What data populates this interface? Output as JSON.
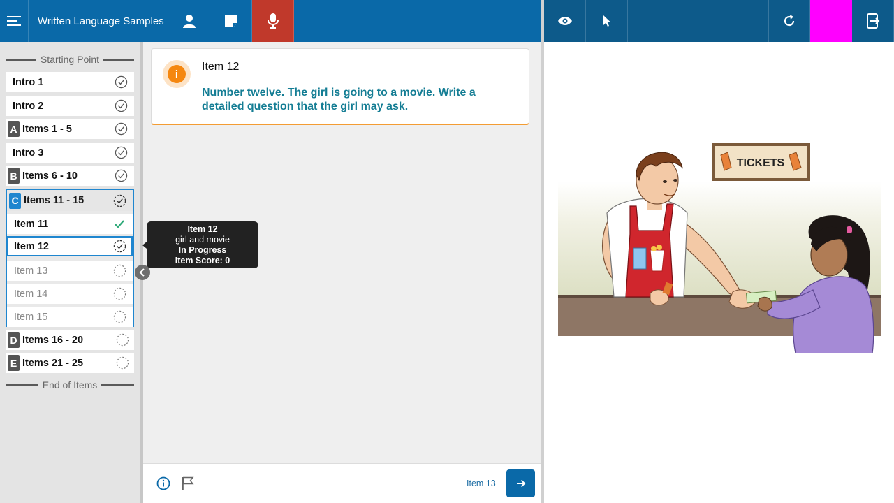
{
  "header": {
    "app_title": "Written Language Samples",
    "icons": [
      "hamburger-menu-icon",
      "person-icon",
      "note-icon",
      "microphone-icon"
    ]
  },
  "examiner_toolbar": {
    "icons": [
      "eye-icon",
      "pointer-icon",
      "refresh-icon",
      "exit-icon"
    ],
    "highlight_color": "#ff00ff"
  },
  "sidebar": {
    "start_label": "Starting Point",
    "end_label": "End of Items",
    "items": [
      {
        "letter": "",
        "label": "Intro 1",
        "status": "complete"
      },
      {
        "letter": "",
        "label": "Intro 2",
        "status": "complete"
      },
      {
        "letter": "A",
        "label": "Items 1 - 5",
        "status": "complete"
      },
      {
        "letter": "",
        "label": "Intro 3",
        "status": "complete"
      },
      {
        "letter": "B",
        "label": "Items 6 - 10",
        "status": "complete"
      },
      {
        "letter": "C",
        "label": "Items 11 - 15",
        "status": "in-progress"
      },
      {
        "letter": "D",
        "label": "Items 16 - 20",
        "status": "not-started"
      },
      {
        "letter": "E",
        "label": "Items 21 - 25",
        "status": "not-started"
      }
    ],
    "sub_items": [
      {
        "label": "Item 11",
        "status": "scored"
      },
      {
        "label": "Item 12",
        "status": "in-progress"
      },
      {
        "label": "Item 13",
        "status": "not-started"
      },
      {
        "label": "Item 14",
        "status": "not-started"
      },
      {
        "label": "Item 15",
        "status": "not-started"
      }
    ]
  },
  "tooltip": {
    "title": "Item 12",
    "subtitle": "girl and movie",
    "status": "In Progress",
    "score": "Item Score: 0"
  },
  "item_card": {
    "title": "Item 12",
    "prompt": "Number twelve. The girl is going to a movie. Write a detailed question that the girl may ask."
  },
  "footer": {
    "next_label": "Item 13"
  },
  "stimulus": {
    "sign_text": "TICKETS"
  },
  "colors": {
    "primary": "#0a69a8",
    "mic_active": "#c0392b",
    "prompt_text": "#147d94",
    "accent_orange": "#f5870f",
    "check_green": "#2aa876"
  }
}
